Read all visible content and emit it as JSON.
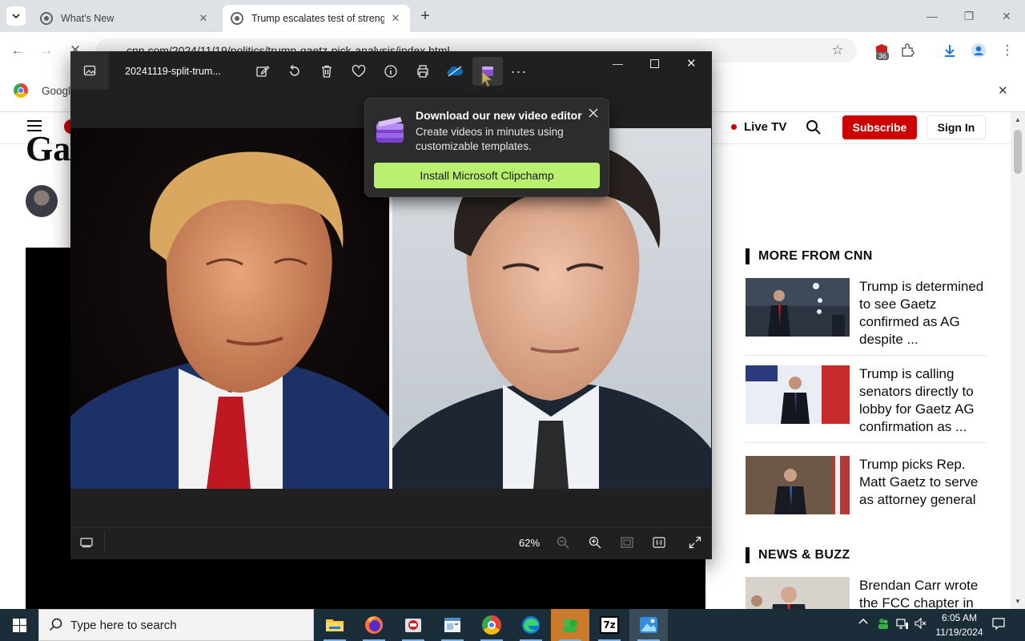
{
  "browser": {
    "tabs": [
      {
        "title": "What's New",
        "active": false
      },
      {
        "title": "Trump escalates test of strength",
        "active": true
      }
    ],
    "new_tab_symbol": "+",
    "url": "cnn.com/2024/11/19/politics/trump-gaetz-pick-analysis/index.html",
    "extension_badge": "36",
    "infobar_text": "Googl",
    "icons": [
      "chevron-down-icon",
      "back-icon",
      "forward-icon",
      "stop-icon",
      "star-icon",
      "extensions-icon",
      "download-icon",
      "profile-icon",
      "menu-icon",
      "close-icon"
    ]
  },
  "cnn": {
    "live_tv": "Live TV",
    "subscribe": "Subscribe",
    "sign_in": "Sign In",
    "headline_fragment": "Ga",
    "sections": [
      {
        "title": "MORE FROM CNN",
        "stories": [
          {
            "text": "Trump is determined to see Gaetz confirmed as AG despite ..."
          },
          {
            "text": "Trump is calling senators directly to lobby for Gaetz AG confirmation as ..."
          },
          {
            "text": "Trump picks Rep. Matt Gaetz to serve as attorney general"
          }
        ]
      },
      {
        "title": "NEWS & BUZZ",
        "stories": [
          {
            "text": "Brendan Carr wrote the FCC chapter in"
          }
        ]
      }
    ]
  },
  "viewer": {
    "file_name": "20241119-split-trum...",
    "toolbar_icons": [
      "gallery-icon",
      "edit-icon",
      "rotate-icon",
      "delete-icon",
      "favorite-icon",
      "info-icon",
      "print-icon",
      "onedrive-icon",
      "clipchamp-icon",
      "more-icon"
    ],
    "zoom": "62%",
    "more_symbol": "···"
  },
  "promo": {
    "title": "Download our new video editor",
    "body": "Create videos in minutes using customizable templates.",
    "button": "Install Microsoft Clipchamp"
  },
  "taskbar": {
    "search_placeholder": "Type here to search",
    "apps": [
      "file-explorer-icon",
      "firefox-icon",
      "app-icon",
      "app-icon",
      "chrome-icon",
      "edge-icon",
      "app-icon",
      "7zip-icon",
      "photos-icon"
    ],
    "seven_zip_label": "7z",
    "time": "6:05 AM",
    "date": "11/19/2024"
  }
}
